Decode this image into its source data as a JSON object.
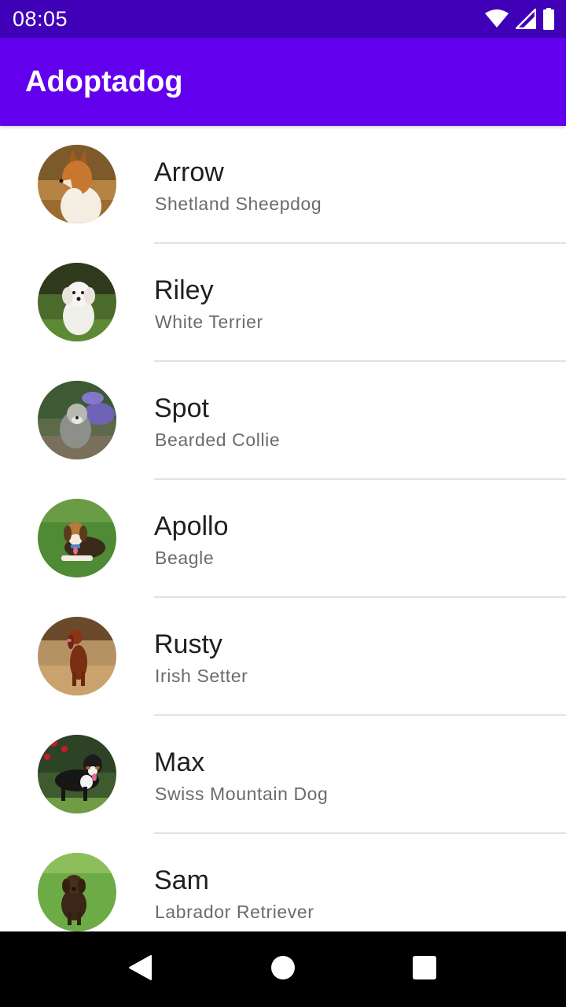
{
  "status_bar": {
    "time": "08:05",
    "icons": [
      "wifi-icon",
      "cell-signal-icon",
      "battery-icon"
    ]
  },
  "app_bar": {
    "title": "Adoptadog"
  },
  "dogs": [
    {
      "name": "Arrow",
      "breed": "Shetland Sheepdog"
    },
    {
      "name": "Riley",
      "breed": "White Terrier"
    },
    {
      "name": "Spot",
      "breed": "Bearded Collie"
    },
    {
      "name": "Apollo",
      "breed": "Beagle"
    },
    {
      "name": "Rusty",
      "breed": "Irish Setter"
    },
    {
      "name": "Max",
      "breed": "Swiss Mountain Dog"
    },
    {
      "name": "Sam",
      "breed": "Labrador Retriever"
    }
  ],
  "navigation_bar": {
    "buttons": [
      "back-icon",
      "home-icon",
      "recents-icon"
    ]
  },
  "colors": {
    "status_bar": "#3f00b8",
    "app_bar": "#6200ee",
    "name_text": "#1f1f1f",
    "breed_text": "#6b6b6b",
    "divider": "#e2e2e2",
    "nav_bar": "#000000"
  }
}
